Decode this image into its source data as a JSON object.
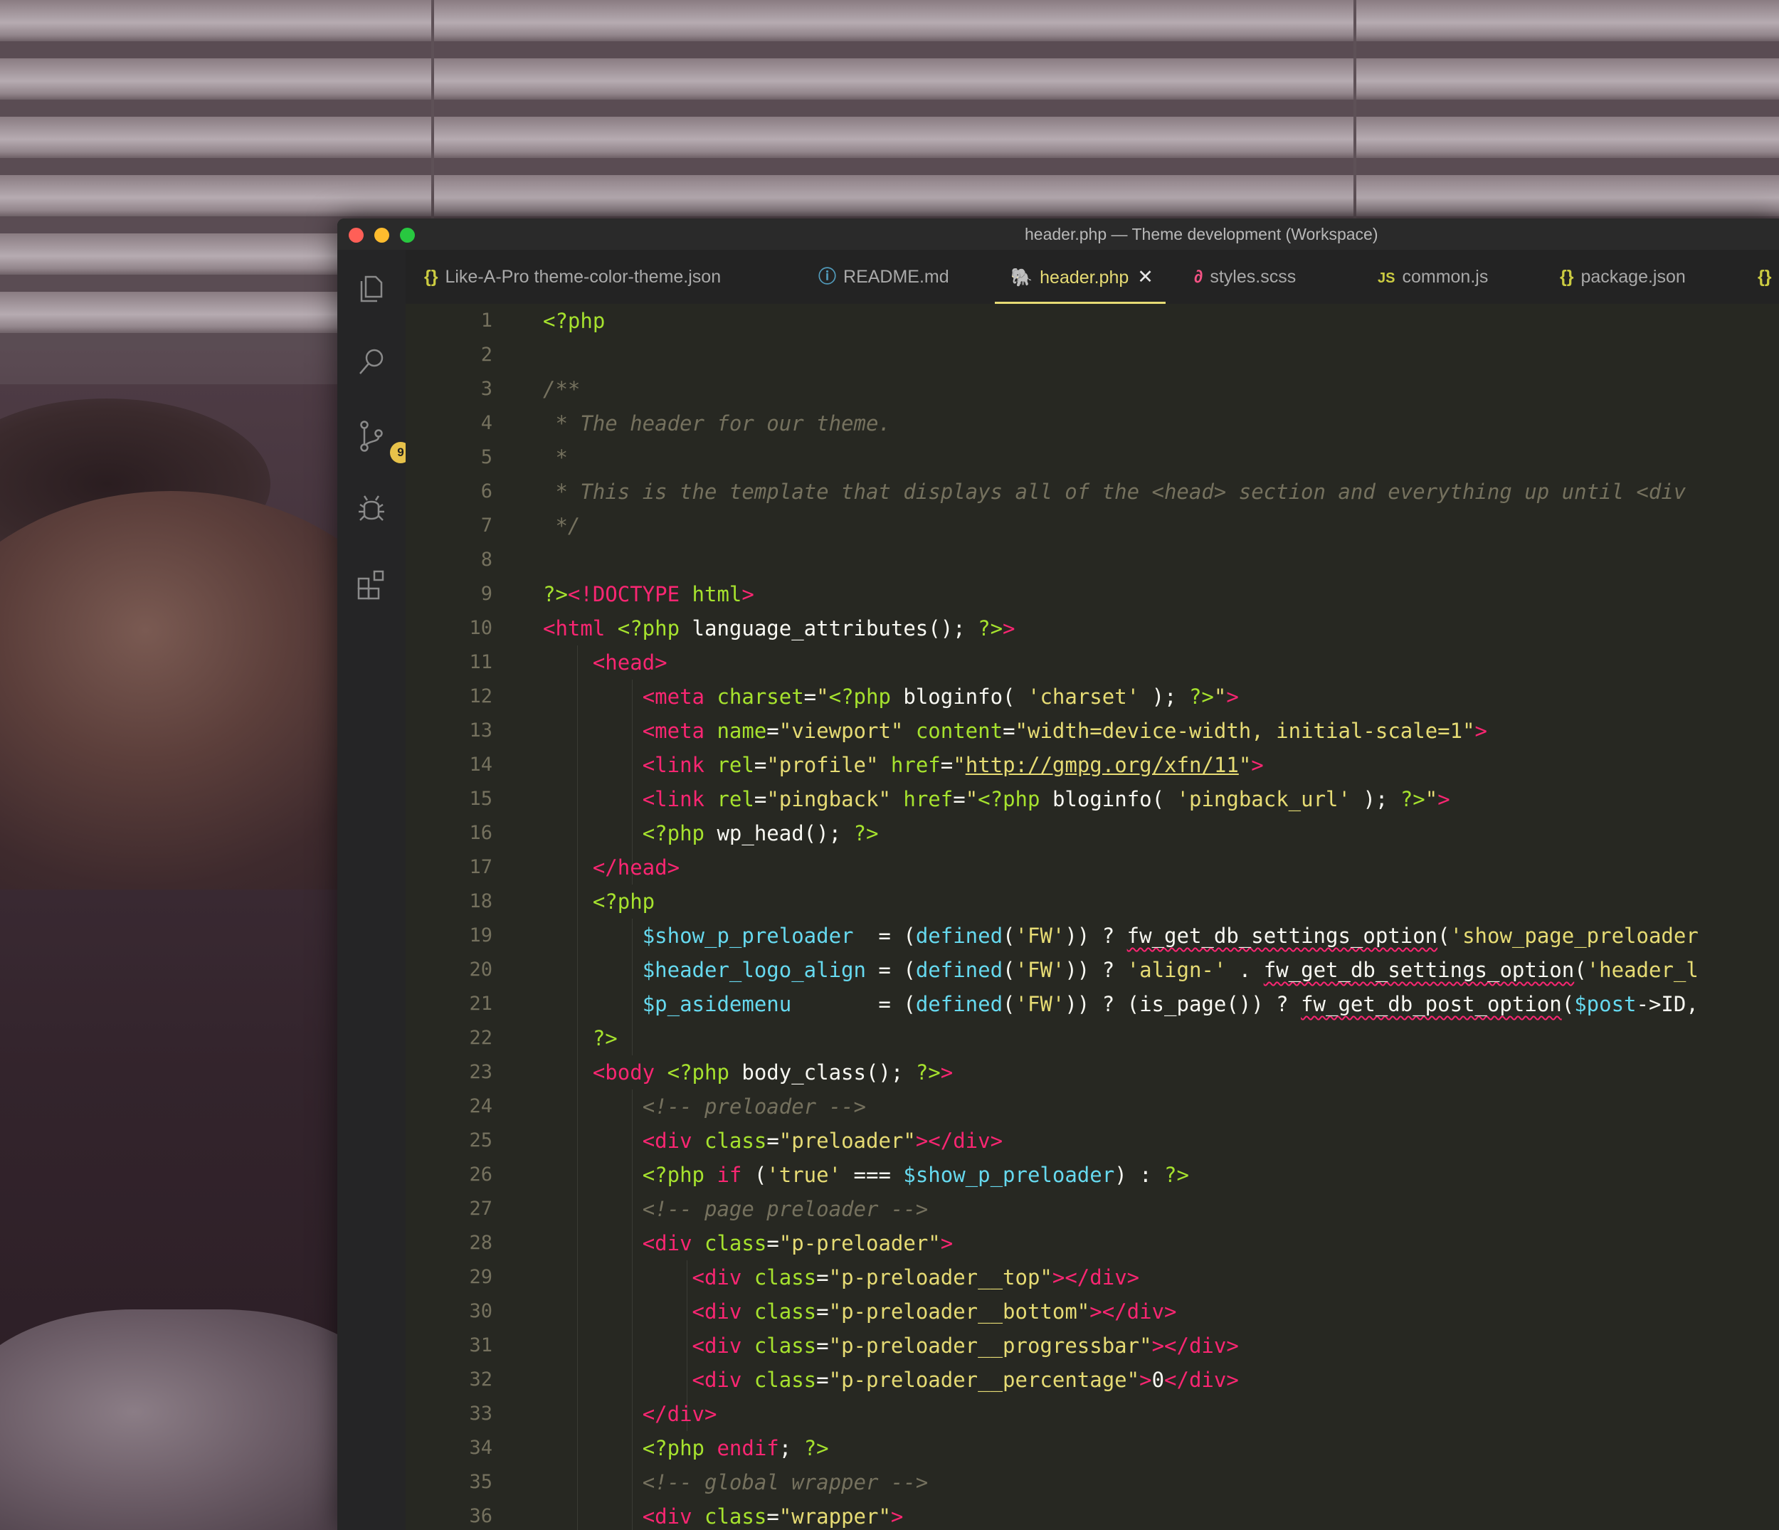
{
  "window": {
    "title": "header.php — Theme development (Workspace)"
  },
  "activity_bar": {
    "items": [
      {
        "name": "explorer-icon"
      },
      {
        "name": "search-icon"
      },
      {
        "name": "source-control-icon",
        "badge": "9"
      },
      {
        "name": "debug-icon"
      },
      {
        "name": "extensions-icon"
      }
    ]
  },
  "tabs": [
    {
      "label": "Like-A-Pro theme-color-theme.json",
      "icon": "{}",
      "icon_name": "json-icon",
      "active": false
    },
    {
      "label": "README.md",
      "icon": "ⓘ",
      "icon_name": "info-icon",
      "active": false
    },
    {
      "label": "header.php",
      "icon": "🐘",
      "icon_name": "php-elephant-icon",
      "active": true
    },
    {
      "label": "styles.scss",
      "icon": "∂",
      "icon_name": "sass-icon",
      "active": false
    },
    {
      "label": "common.js",
      "icon": "JS",
      "icon_name": "js-icon",
      "active": false
    },
    {
      "label": "package.json",
      "icon": "{}",
      "icon_name": "json-icon",
      "active": false
    },
    {
      "label": "",
      "icon": "{}",
      "icon_name": "json-icon",
      "active": false
    }
  ],
  "editor": {
    "lines": [
      [
        [
          "at",
          "<?php"
        ]
      ],
      [],
      [
        [
          "cm",
          "/**"
        ]
      ],
      [
        [
          "cm",
          " * The header for our theme."
        ]
      ],
      [
        [
          "cm",
          " *"
        ]
      ],
      [
        [
          "cm",
          " * This is the template that displays all of the <head> section and everything up until <div"
        ]
      ],
      [
        [
          "cm",
          " */"
        ]
      ],
      [],
      [
        [
          "at",
          "?>"
        ],
        [
          "tg",
          "<!DOCTYPE "
        ],
        [
          "at",
          "html"
        ],
        [
          "tg",
          ">"
        ]
      ],
      [
        [
          "tg",
          "<html "
        ],
        [
          "at",
          "<?php "
        ],
        [
          "pl",
          "language_attributes(); "
        ],
        [
          "at",
          "?>"
        ],
        [
          "tg",
          ">"
        ]
      ],
      [
        [
          "pl",
          "    "
        ],
        [
          "tg",
          "<head>"
        ]
      ],
      [
        [
          "pl",
          "        "
        ],
        [
          "tg",
          "<meta "
        ],
        [
          "at",
          "charset"
        ],
        [
          "pl",
          "="
        ],
        [
          "st",
          "\""
        ],
        [
          "at",
          "<?php "
        ],
        [
          "pl",
          "bloginfo( "
        ],
        [
          "st",
          "'charset'"
        ],
        [
          "pl",
          " ); "
        ],
        [
          "at",
          "?>"
        ],
        [
          "st",
          "\""
        ],
        [
          "tg",
          ">"
        ]
      ],
      [
        [
          "pl",
          "        "
        ],
        [
          "tg",
          "<meta "
        ],
        [
          "at",
          "name"
        ],
        [
          "pl",
          "="
        ],
        [
          "st",
          "\"viewport\""
        ],
        [
          "pl",
          " "
        ],
        [
          "at",
          "content"
        ],
        [
          "pl",
          "="
        ],
        [
          "st",
          "\"width=device-width, initial-scale=1\""
        ],
        [
          "tg",
          ">"
        ]
      ],
      [
        [
          "pl",
          "        "
        ],
        [
          "tg",
          "<link "
        ],
        [
          "at",
          "rel"
        ],
        [
          "pl",
          "="
        ],
        [
          "st",
          "\"profile\""
        ],
        [
          "pl",
          " "
        ],
        [
          "at",
          "href"
        ],
        [
          "pl",
          "="
        ],
        [
          "st",
          "\""
        ],
        [
          "stu",
          "http://gmpg.org/xfn/11"
        ],
        [
          "st",
          "\""
        ],
        [
          "tg",
          ">"
        ]
      ],
      [
        [
          "pl",
          "        "
        ],
        [
          "tg",
          "<link "
        ],
        [
          "at",
          "rel"
        ],
        [
          "pl",
          "="
        ],
        [
          "st",
          "\"pingback\""
        ],
        [
          "pl",
          " "
        ],
        [
          "at",
          "href"
        ],
        [
          "pl",
          "="
        ],
        [
          "st",
          "\""
        ],
        [
          "at",
          "<?php "
        ],
        [
          "pl",
          "bloginfo( "
        ],
        [
          "st",
          "'pingback_url'"
        ],
        [
          "pl",
          " ); "
        ],
        [
          "at",
          "?>"
        ],
        [
          "st",
          "\""
        ],
        [
          "tg",
          ">"
        ]
      ],
      [
        [
          "pl",
          "        "
        ],
        [
          "at",
          "<?php "
        ],
        [
          "pl",
          "wp_head(); "
        ],
        [
          "at",
          "?>"
        ]
      ],
      [
        [
          "pl",
          "    "
        ],
        [
          "tg",
          "</head>"
        ]
      ],
      [
        [
          "pl",
          "    "
        ],
        [
          "at",
          "<?php"
        ]
      ],
      [
        [
          "pl",
          "        "
        ],
        [
          "vr",
          "$show_p_preloader"
        ],
        [
          "pl",
          "  = ("
        ],
        [
          "vr",
          "defined"
        ],
        [
          "pl",
          "("
        ],
        [
          "st",
          "'FW'"
        ],
        [
          "pl",
          ")) ? "
        ],
        [
          "sq",
          "fw_get_db_settings_option"
        ],
        [
          "pl",
          "("
        ],
        [
          "st",
          "'show_page_preloader"
        ]
      ],
      [
        [
          "pl",
          "        "
        ],
        [
          "vr",
          "$header_logo_align"
        ],
        [
          "pl",
          " = ("
        ],
        [
          "vr",
          "defined"
        ],
        [
          "pl",
          "("
        ],
        [
          "st",
          "'FW'"
        ],
        [
          "pl",
          ")) ? "
        ],
        [
          "st",
          "'align-'"
        ],
        [
          "pl",
          " . "
        ],
        [
          "sq",
          "fw_get_db_settings_option"
        ],
        [
          "pl",
          "("
        ],
        [
          "st",
          "'header_l"
        ]
      ],
      [
        [
          "pl",
          "        "
        ],
        [
          "vr",
          "$p_asidemenu"
        ],
        [
          "pl",
          "       = ("
        ],
        [
          "vr",
          "defined"
        ],
        [
          "pl",
          "("
        ],
        [
          "st",
          "'FW'"
        ],
        [
          "pl",
          ")) ? (is_page()) ? "
        ],
        [
          "sq",
          "fw_get_db_post_option"
        ],
        [
          "pl",
          "("
        ],
        [
          "vr",
          "$post"
        ],
        [
          "pl",
          "->ID,"
        ]
      ],
      [
        [
          "pl",
          "    "
        ],
        [
          "at",
          "?>"
        ]
      ],
      [
        [
          "pl",
          "    "
        ],
        [
          "tg",
          "<body "
        ],
        [
          "at",
          "<?php "
        ],
        [
          "pl",
          "body_class(); "
        ],
        [
          "at",
          "?>"
        ],
        [
          "tg",
          ">"
        ]
      ],
      [
        [
          "pl",
          "        "
        ],
        [
          "cm",
          "<!-- preloader -->"
        ]
      ],
      [
        [
          "pl",
          "        "
        ],
        [
          "tg",
          "<div "
        ],
        [
          "at",
          "class"
        ],
        [
          "pl",
          "="
        ],
        [
          "st",
          "\"preloader\""
        ],
        [
          "tg",
          "></div>"
        ]
      ],
      [
        [
          "pl",
          "        "
        ],
        [
          "at",
          "<?php "
        ],
        [
          "tg",
          "if"
        ],
        [
          "pl",
          " ("
        ],
        [
          "st",
          "'true'"
        ],
        [
          "pl",
          " === "
        ],
        [
          "vr",
          "$show_p_preloader"
        ],
        [
          "pl",
          ") : "
        ],
        [
          "at",
          "?>"
        ]
      ],
      [
        [
          "pl",
          "        "
        ],
        [
          "cm",
          "<!-- page preloader -->"
        ]
      ],
      [
        [
          "pl",
          "        "
        ],
        [
          "tg",
          "<div "
        ],
        [
          "at",
          "class"
        ],
        [
          "pl",
          "="
        ],
        [
          "st",
          "\"p-preloader\""
        ],
        [
          "tg",
          ">"
        ]
      ],
      [
        [
          "pl",
          "            "
        ],
        [
          "tg",
          "<div "
        ],
        [
          "at",
          "class"
        ],
        [
          "pl",
          "="
        ],
        [
          "st",
          "\"p-preloader__top\""
        ],
        [
          "tg",
          "></div>"
        ]
      ],
      [
        [
          "pl",
          "            "
        ],
        [
          "tg",
          "<div "
        ],
        [
          "at",
          "class"
        ],
        [
          "pl",
          "="
        ],
        [
          "st",
          "\"p-preloader__bottom\""
        ],
        [
          "tg",
          "></div>"
        ]
      ],
      [
        [
          "pl",
          "            "
        ],
        [
          "tg",
          "<div "
        ],
        [
          "at",
          "class"
        ],
        [
          "pl",
          "="
        ],
        [
          "st",
          "\"p-preloader__progressbar\""
        ],
        [
          "tg",
          "></div>"
        ]
      ],
      [
        [
          "pl",
          "            "
        ],
        [
          "tg",
          "<div "
        ],
        [
          "at",
          "class"
        ],
        [
          "pl",
          "="
        ],
        [
          "st",
          "\"p-preloader__percentage\""
        ],
        [
          "tg",
          ">"
        ],
        [
          "pl",
          "0"
        ],
        [
          "tg",
          "</div>"
        ]
      ],
      [
        [
          "pl",
          "        "
        ],
        [
          "tg",
          "</div>"
        ]
      ],
      [
        [
          "pl",
          "        "
        ],
        [
          "at",
          "<?php "
        ],
        [
          "tg",
          "endif"
        ],
        [
          "pl",
          "; "
        ],
        [
          "at",
          "?>"
        ]
      ],
      [
        [
          "pl",
          "        "
        ],
        [
          "cm",
          "<!-- global wrapper -->"
        ]
      ],
      [
        [
          "pl",
          "        "
        ],
        [
          "tg",
          "<div "
        ],
        [
          "at",
          "class"
        ],
        [
          "pl",
          "="
        ],
        [
          "st",
          "\"wrapper\""
        ],
        [
          "tg",
          ">"
        ]
      ]
    ]
  },
  "colors": {
    "tag": "#f92672",
    "attribute": "#a6e22e",
    "string": "#e6db74",
    "comment": "#75715e",
    "variable": "#66d9ef",
    "plain": "#f8f8f2",
    "editor_bg": "#272822",
    "badge": "#e7c24a"
  }
}
